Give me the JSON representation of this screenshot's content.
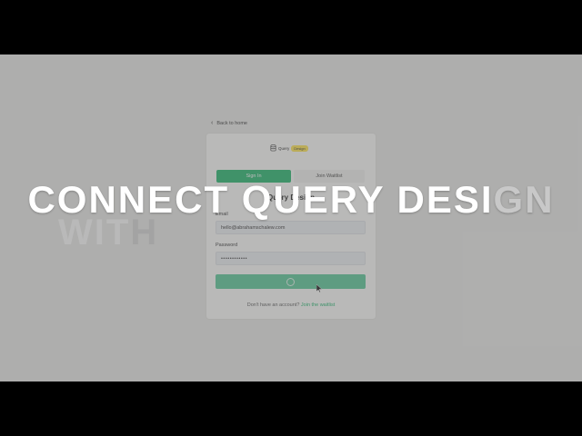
{
  "back_link": "Back to home",
  "logo": {
    "text": "Query",
    "badge": "Design"
  },
  "tabs": {
    "sign_in": "Sign In",
    "waitlist": "Join Waitlist"
  },
  "card_heading": "Query Design",
  "email": {
    "label": "Email",
    "value": "hello@abrahamschalew.com"
  },
  "password": {
    "label": "Password",
    "value": "••••••••••••"
  },
  "footer": {
    "text": "Don't have an account?",
    "link": "Join the waitlist"
  },
  "overlay": {
    "headline_main": "CONNECT QUERY DESI",
    "headline_fade": "GN",
    "subword_main": "WIT",
    "subword_fade": "H"
  },
  "colors": {
    "accent": "#1fb56b",
    "badge": "#ffe44d",
    "overlay_text": "#ffffff"
  },
  "icons": {
    "back": "chevron-left-icon",
    "logo": "database-icon",
    "loading": "spinner-icon",
    "pointer": "cursor-icon"
  }
}
